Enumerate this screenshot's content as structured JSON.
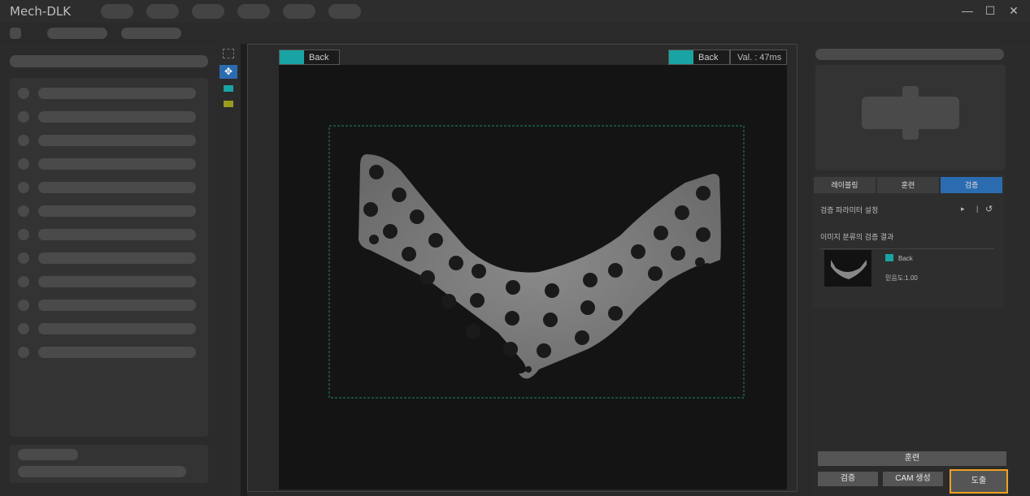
{
  "app": {
    "title": "Mech-DLK"
  },
  "window_controls": {
    "minimize": "—",
    "maximize": "☐",
    "close": "✕"
  },
  "viewer": {
    "left_label": {
      "name": "Back",
      "color": "#1aa3a3"
    },
    "right_label": {
      "name": "Back",
      "color": "#1aa3a3"
    },
    "val_text": "Val. : 47ms"
  },
  "right_panel": {
    "tabs": [
      {
        "label": "레이블링",
        "active": false
      },
      {
        "label": "훈련",
        "active": false
      },
      {
        "label": "검증",
        "active": true
      }
    ],
    "param_settings": "검증 파라미터 설정",
    "result_title": "이미지 분류의 검증 결과",
    "result_class": "Back",
    "result_confidence": "믿음도:1.00",
    "buttons": {
      "train": "훈련",
      "validate": "검증",
      "cam": "CAM 생성",
      "export": "도출"
    }
  },
  "colors": {
    "accent": "#2b6cb0",
    "label": "#1aa3a3",
    "highlight": "#f0a020"
  }
}
